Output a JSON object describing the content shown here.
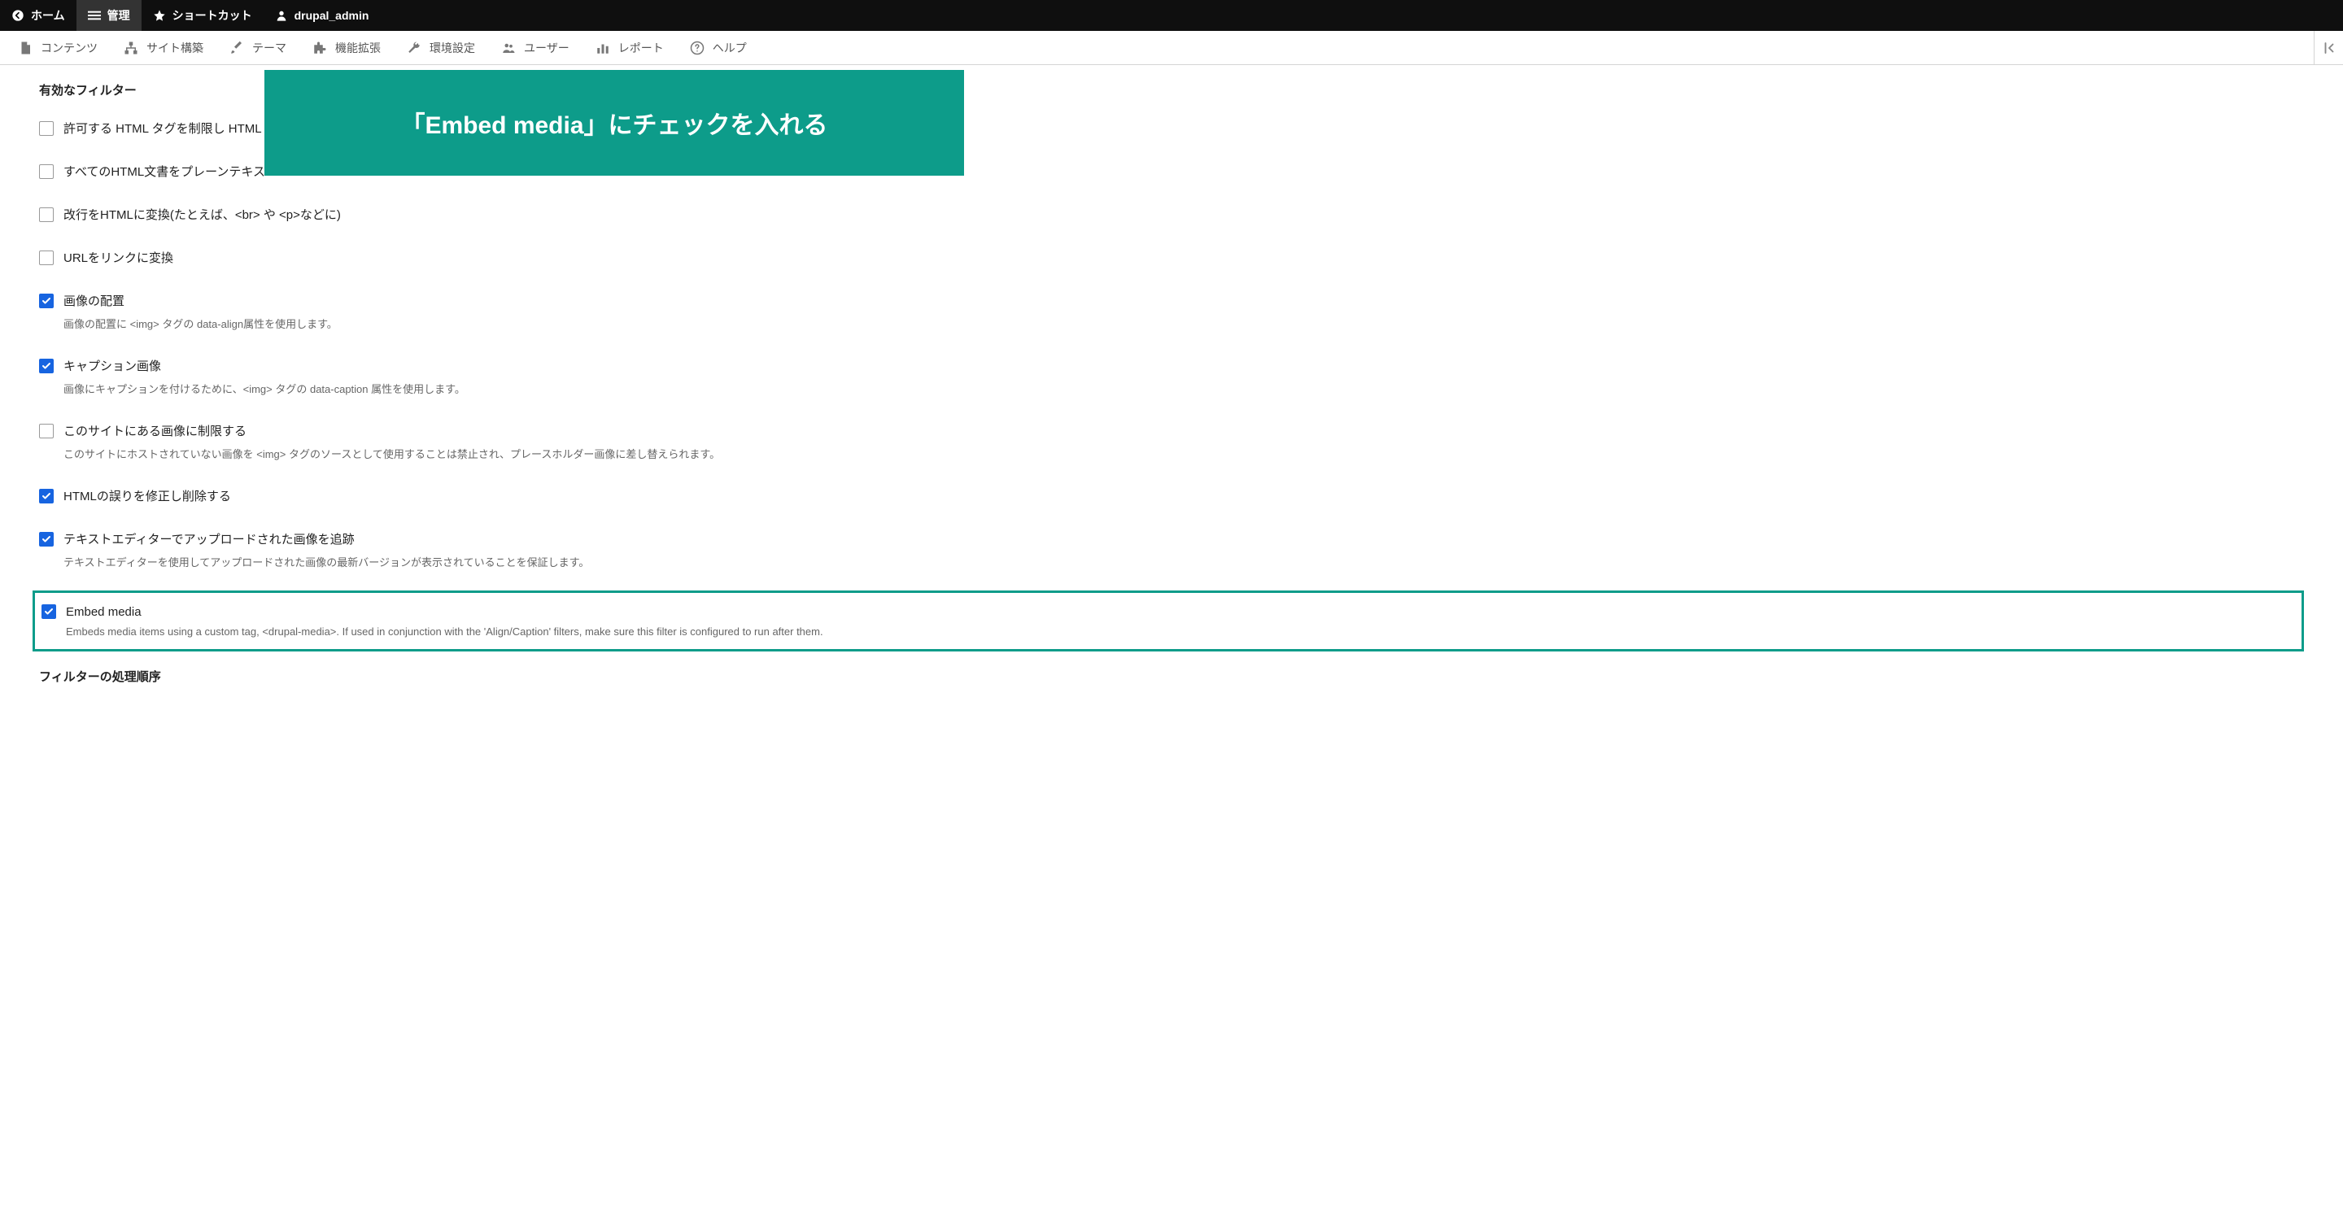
{
  "toolbar": {
    "home": "ホーム",
    "manage": "管理",
    "shortcut": "ショートカット",
    "user": "drupal_admin"
  },
  "admin_menu": {
    "content": "コンテンツ",
    "structure": "サイト構築",
    "appearance": "テーマ",
    "extend": "機能拡張",
    "config": "環境設定",
    "people": "ユーザー",
    "reports": "レポート",
    "help": "ヘルプ"
  },
  "callout": "「Embed media」にチェックを入れる",
  "page": {
    "filters_title": "有効なフィルター",
    "processing_order_title": "フィルターの処理順序",
    "filters": [
      {
        "label": "許可する HTML タグを制限し HTML",
        "checked": false,
        "desc": ""
      },
      {
        "label": "すべてのHTML文書をプレーンテキス",
        "checked": false,
        "desc": ""
      },
      {
        "label": "改行をHTMLに変換(たとえば、<br> や <p>などに)",
        "checked": false,
        "desc": ""
      },
      {
        "label": "URLをリンクに変換",
        "checked": false,
        "desc": ""
      },
      {
        "label": "画像の配置",
        "checked": true,
        "desc": "画像の配置に <img> タグの data-align属性を使用します。"
      },
      {
        "label": "キャプション画像",
        "checked": true,
        "desc": "画像にキャプションを付けるために、<img> タグの data-caption 属性を使用します。"
      },
      {
        "label": "このサイトにある画像に制限する",
        "checked": false,
        "desc": "このサイトにホストされていない画像を <img> タグのソースとして使用することは禁止され、プレースホルダー画像に差し替えられます。"
      },
      {
        "label": "HTMLの誤りを修正し削除する",
        "checked": true,
        "desc": ""
      },
      {
        "label": "テキストエディターでアップロードされた画像を追跡",
        "checked": true,
        "desc": "テキストエディターを使用してアップロードされた画像の最新バージョンが表示されていることを保証します。"
      },
      {
        "label": "Embed media",
        "checked": true,
        "desc": "Embeds media items using a custom tag, <drupal-media>. If used in conjunction with the 'Align/Caption' filters, make sure this filter is configured to run after them."
      }
    ]
  }
}
